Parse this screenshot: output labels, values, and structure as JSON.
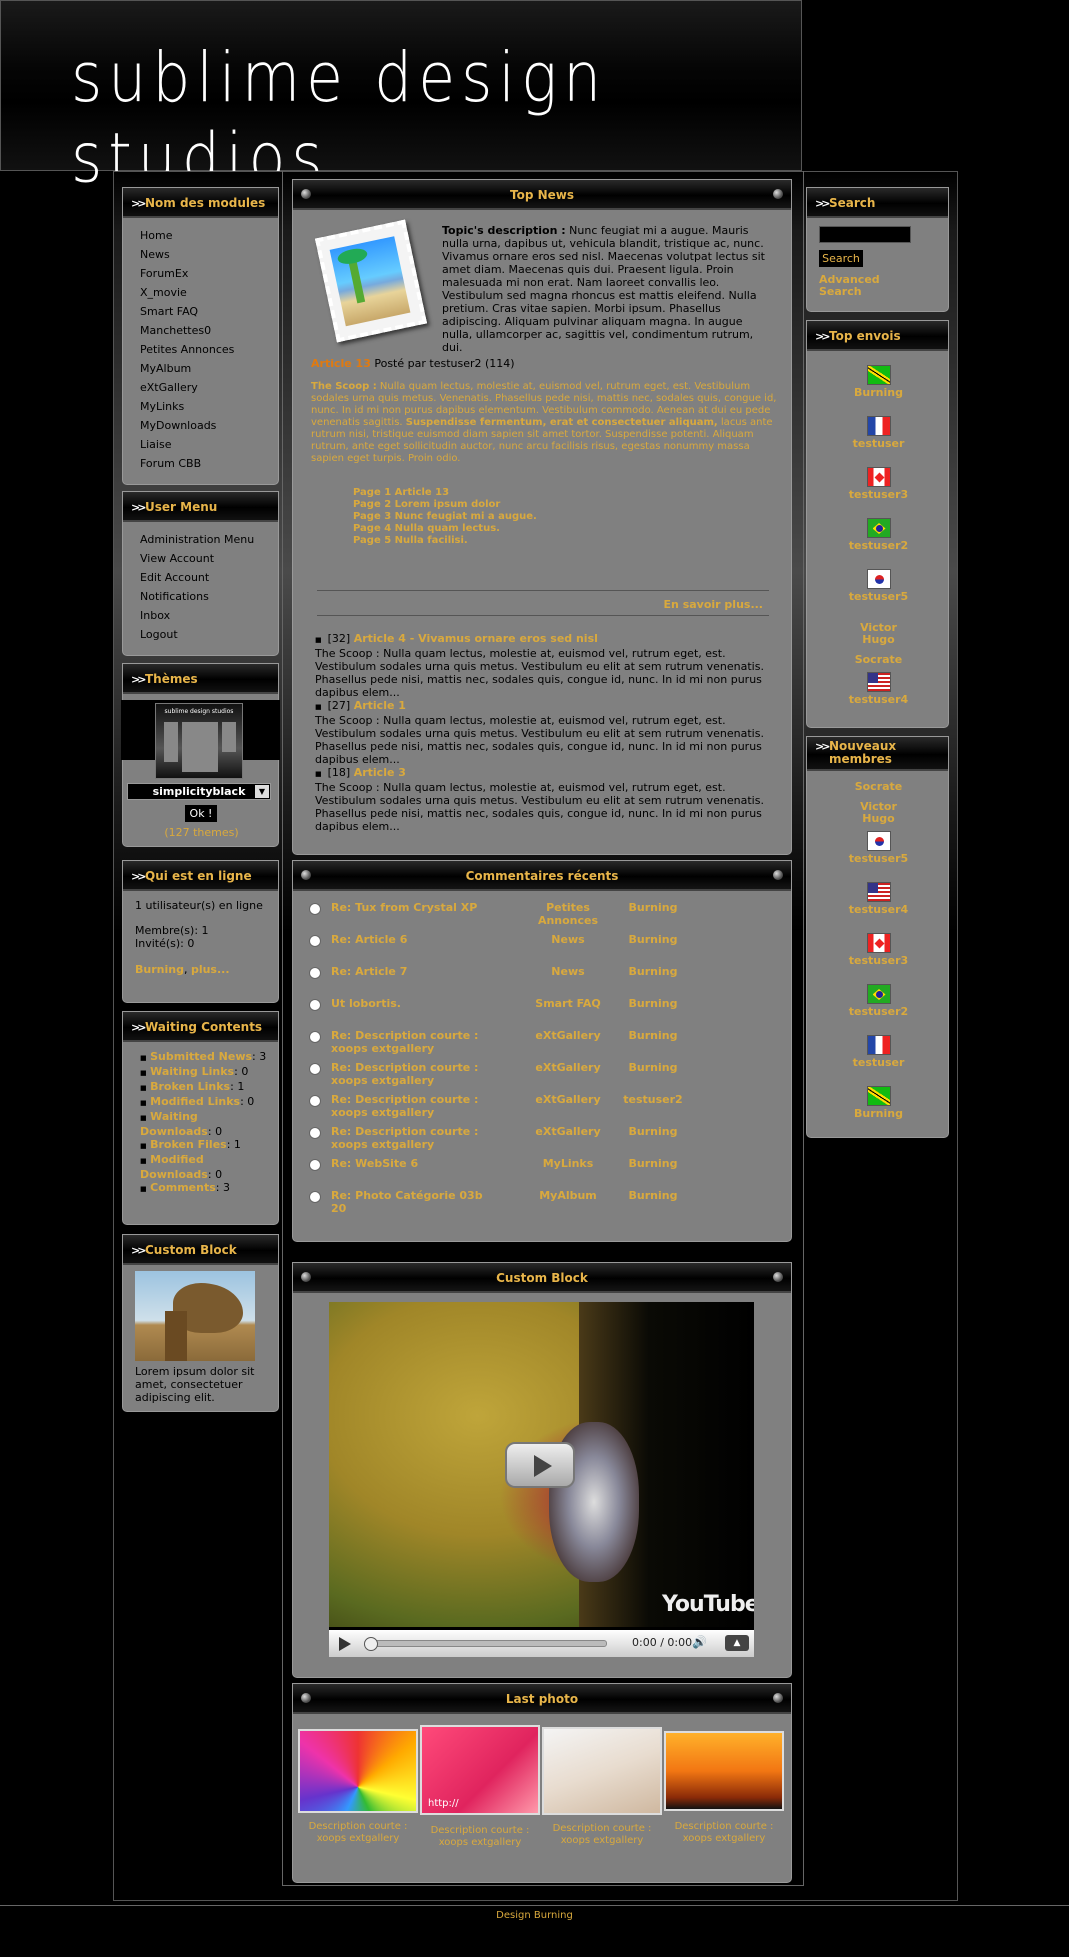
{
  "header": {
    "logo": "sublime design studios"
  },
  "left": {
    "modules": {
      "title": "Nom des modules",
      "items": [
        "Home",
        "News",
        "ForumEx",
        "X_movie",
        "Smart FAQ",
        "Manchettes0",
        "Petites Annonces",
        "MyAlbum",
        "eXtGallery",
        "MyLinks",
        "MyDownloads",
        "Liaise",
        "Forum CBB"
      ]
    },
    "usermenu": {
      "title": "User Menu",
      "items": [
        "Administration Menu",
        "View Account",
        "Edit Account",
        "Notifications",
        "Inbox",
        "Logout"
      ]
    },
    "themes": {
      "title": "Thèmes",
      "selected": "simplicityblack",
      "ok": "Ok !",
      "count": "(127 themes)",
      "thumb_title": "sublime design studios"
    },
    "online": {
      "title": "Qui est en ligne",
      "line1": "1 utilisateur(s) en ligne",
      "members": "Membre(s): 1",
      "guests": "Invité(s): 0",
      "user": "Burning",
      "more": "plus..."
    },
    "waiting": {
      "title": "Waiting Contents",
      "items": [
        {
          "label": "Submitted News",
          "count": "3"
        },
        {
          "label": "Waiting Links",
          "count": "0"
        },
        {
          "label": "Broken Links",
          "count": "1"
        },
        {
          "label": "Modified Links",
          "count": "0"
        },
        {
          "label": "Waiting Downloads",
          "count": "0"
        },
        {
          "label": "Broken Files",
          "count": "1"
        },
        {
          "label": "Modified Downloads",
          "count": "0"
        },
        {
          "label": "Comments",
          "count": "3"
        }
      ]
    },
    "custom": {
      "title": "Custom Block",
      "text": "Lorem ipsum dolor sit amet, consectetuer adipiscing elit."
    }
  },
  "topnews": {
    "title": "Top News",
    "desc_label": "Topic's description :",
    "desc": "Nunc feugiat mi a augue. Mauris nulla urna, dapibus ut, vehicula blandit, tristique ac, nunc. Vivamus ornare eros sed nisl. Maecenas volutpat lectus sit amet diam. Maecenas quis dui. Praesent ligula. Proin malesuada mi non erat. Nam laoreet convallis leo. Vestibulum sed magna rhoncus est mattis eleifend. Nulla pretium. Cras vitae sapien. Morbi ipsum. Phasellus adipiscing. Aliquam pulvinar aliquam magna. In augue nulla, ullamcorper ac, sagittis vel, condimentum rutrum, dui.",
    "article_title": "Article 13",
    "posted": "Posté par testuser2 (114)",
    "scoop_label": "The Scoop :",
    "scoop": "Nulla quam lectus, molestie at, euismod vel, rutrum eget, est. Vestibulum sodales urna quis metus. Venenatis. Phasellus pede nisi, mattis nec, sodales quis, congue id, nunc. In id mi non purus dapibus elementum. Vestibulum commodo. Aenean at dui eu pede venenatis sagittis.",
    "scoop_bold": "Suspendisse fermentum, erat et consectetuer aliquam,",
    "scoop2": "lacus ante rutrum nisi, tristique euismod diam sapien sit amet tortor. Suspendisse potenti. Aliquam rutrum, ante eget sollicitudin auctor, nunc arcu facilisis risus, egestas nonummy massa sapien eget turpis. Proin odio.",
    "pages": [
      "Page 1 Article 13",
      "Page 2 Lorem ipsum dolor",
      "Page 3 Nunc feugiat mi a augue.",
      "Page 4 Nulla quam lectus.",
      "Page 5 Nulla facilisi."
    ],
    "more": "En savoir plus...",
    "others": [
      {
        "count": "[32]",
        "title": "Article 4 - Vivamus ornare eros sed nisl",
        "text": "The Scoop : Nulla quam lectus, molestie at, euismod vel, rutrum eget, est. Vestibulum sodales urna quis metus. Vestibulum eu elit at sem rutrum venenatis. Phasellus pede nisi, mattis nec, sodales quis, congue id, nunc. In id mi non purus dapibus elem..."
      },
      {
        "count": "[27]",
        "title": "Article 1",
        "text": "The Scoop : Nulla quam lectus, molestie at, euismod vel, rutrum eget, est. Vestibulum sodales urna quis metus. Vestibulum eu elit at sem rutrum venenatis. Phasellus pede nisi, mattis nec, sodales quis, congue id, nunc. In id mi non purus dapibus elem..."
      },
      {
        "count": "[18]",
        "title": "Article 3",
        "text": "The Scoop : Nulla quam lectus, molestie at, euismod vel, rutrum eget, est. Vestibulum sodales urna quis metus. Vestibulum eu elit at sem rutrum venenatis. Phasellus pede nisi, mattis nec, sodales quis, congue id, nunc. In id mi non purus dapibus elem..."
      }
    ]
  },
  "comments": {
    "title": "Commentaires récents",
    "rows": [
      {
        "title": "Re: Tux from Crystal XP",
        "module": "Petites Annonces",
        "user": "Burning"
      },
      {
        "title": "Re: Article 6",
        "module": "News",
        "user": "Burning"
      },
      {
        "title": "Re: Article 7",
        "module": "News",
        "user": "Burning"
      },
      {
        "title": "Ut lobortis.",
        "module": "Smart FAQ",
        "user": "Burning"
      },
      {
        "title": "Re: Description courte : xoops extgallery",
        "module": "eXtGallery",
        "user": "Burning"
      },
      {
        "title": "Re: Description courte : xoops extgallery",
        "module": "eXtGallery",
        "user": "Burning"
      },
      {
        "title": "Re: Description courte : xoops extgallery",
        "module": "eXtGallery",
        "user": "testuser2"
      },
      {
        "title": "Re: Description courte : xoops extgallery",
        "module": "eXtGallery",
        "user": "Burning"
      },
      {
        "title": "Re: WebSite 6",
        "module": "MyLinks",
        "user": "Burning"
      },
      {
        "title": "Re: Photo Catégorie 03b 20",
        "module": "MyAlbum",
        "user": "Burning"
      }
    ]
  },
  "customblock": {
    "title": "Custom Block",
    "time": "0:00 / 0:00",
    "yt": "YouTube"
  },
  "lastphoto": {
    "title": "Last photo",
    "captions": [
      "Description courte : xoops extgallery",
      "Description courte : xoops extgallery",
      "Description courte : xoops extgallery",
      "Description courte : xoops extgallery"
    ],
    "url_text": "http://"
  },
  "right": {
    "search": {
      "title": "Search",
      "button": "Search",
      "advanced": "Advanced Search"
    },
    "topenvois": {
      "title": "Top envois",
      "users": [
        {
          "name": "Burning",
          "flag": "fl-jm"
        },
        {
          "name": "testuser",
          "flag": "fl-fr"
        },
        {
          "name": "testuser3",
          "flag": "fl-ca"
        },
        {
          "name": "testuser2",
          "flag": "fl-br"
        },
        {
          "name": "testuser5",
          "flag": "fl-kr"
        },
        {
          "name": "Victor Hugo",
          "flag": ""
        },
        {
          "name": "Socrate",
          "flag": ""
        },
        {
          "name": "testuser4",
          "flag": "fl-us"
        }
      ]
    },
    "nouveaux": {
      "title": "Nouveaux membres",
      "users": [
        {
          "name": "Socrate",
          "flag": ""
        },
        {
          "name": "Victor Hugo",
          "flag": ""
        },
        {
          "name": "testuser5",
          "flag": "fl-kr"
        },
        {
          "name": "testuser4",
          "flag": "fl-us"
        },
        {
          "name": "testuser3",
          "flag": "fl-ca"
        },
        {
          "name": "testuser2",
          "flag": "fl-br"
        },
        {
          "name": "testuser",
          "flag": "fl-fr"
        },
        {
          "name": "Burning",
          "flag": "fl-jm"
        }
      ]
    }
  },
  "footer": {
    "text": "Design Burning"
  }
}
